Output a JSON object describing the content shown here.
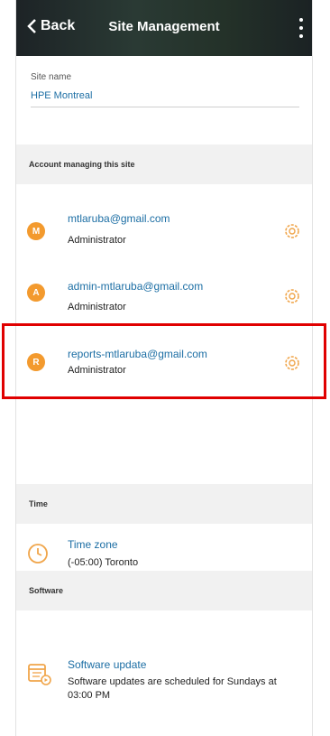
{
  "header": {
    "back_label": "Back",
    "title": "Site Management"
  },
  "site": {
    "label": "Site name",
    "value": "HPE Montreal"
  },
  "accounts": {
    "section_title": "Account managing this site",
    "items": [
      {
        "initial": "M",
        "email": "mtlaruba@gmail.com",
        "role": "Administrator"
      },
      {
        "initial": "A",
        "email": "admin-mtlaruba@gmail.com",
        "role": "Administrator"
      },
      {
        "initial": "R",
        "email": "reports-mtlaruba@gmail.com",
        "role": "Administrator"
      }
    ]
  },
  "time": {
    "section_title": "Time",
    "link": "Time zone",
    "value": "(-05:00) Toronto"
  },
  "software": {
    "section_title": "Software",
    "link": "Software update",
    "desc": "Software updates are scheduled for Sundays at 03:00 PM"
  },
  "colors": {
    "accent": "#1c6ea4",
    "avatar": "#f39a2e",
    "highlight": "#e00000"
  }
}
